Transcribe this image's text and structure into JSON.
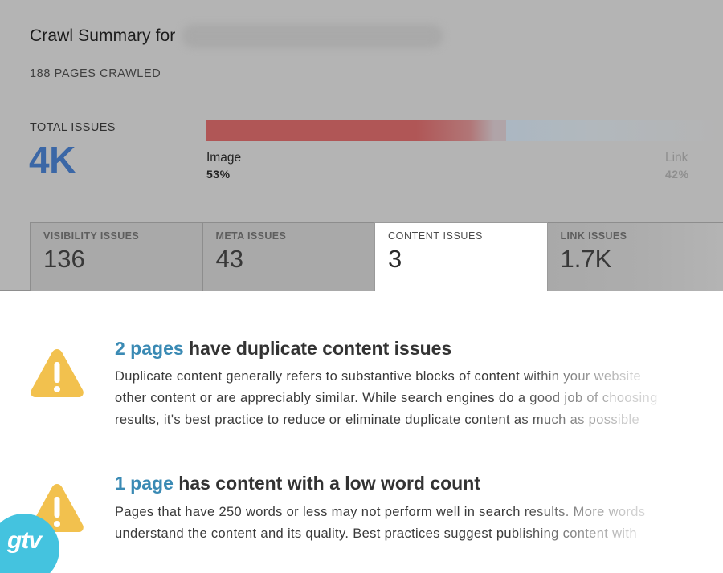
{
  "header": {
    "title": "Crawl Summary for",
    "pages_crawled": "188 PAGES CRAWLED"
  },
  "summary": {
    "total_label": "TOTAL ISSUES",
    "total_value": "4K",
    "distribution": [
      {
        "label": "Image",
        "percent_text": "53%",
        "share": 0.58,
        "color": "#b05656"
      },
      {
        "label": "Link",
        "percent_text": "42%",
        "share": 0.42,
        "color": "#abb7c2"
      }
    ]
  },
  "tabs": [
    {
      "label": "VISIBILITY ISSUES",
      "value": "136",
      "active": false
    },
    {
      "label": "META ISSUES",
      "value": "43",
      "active": false
    },
    {
      "label": "CONTENT ISSUES",
      "value": "3",
      "active": true
    },
    {
      "label": "LINK ISSUES",
      "value": "1.7K",
      "active": false
    }
  ],
  "issues": [
    {
      "count_text": "2 pages",
      "title_rest": " have duplicate content issues",
      "lines": [
        "Duplicate content generally refers to substantive blocks of content within your website",
        "other content or are appreciably similar. While search engines do a good job of choosing",
        "results, it's best practice to reduce or eliminate duplicate content as much as possible"
      ]
    },
    {
      "count_text": "1 page",
      "title_rest": " has content with a low word count",
      "lines": [
        "Pages that have 250 words or less may not perform well in search results. More words",
        "understand the content and its quality. Best practices suggest publishing content with"
      ]
    }
  ],
  "icons": {
    "warning": "warning-triangle-icon"
  },
  "colors": {
    "accent": "#3a8ab4",
    "total": "#3b67a6",
    "warning": "#f2c14e",
    "logo": "#44c3df"
  },
  "logo": {
    "text": "gtv"
  }
}
